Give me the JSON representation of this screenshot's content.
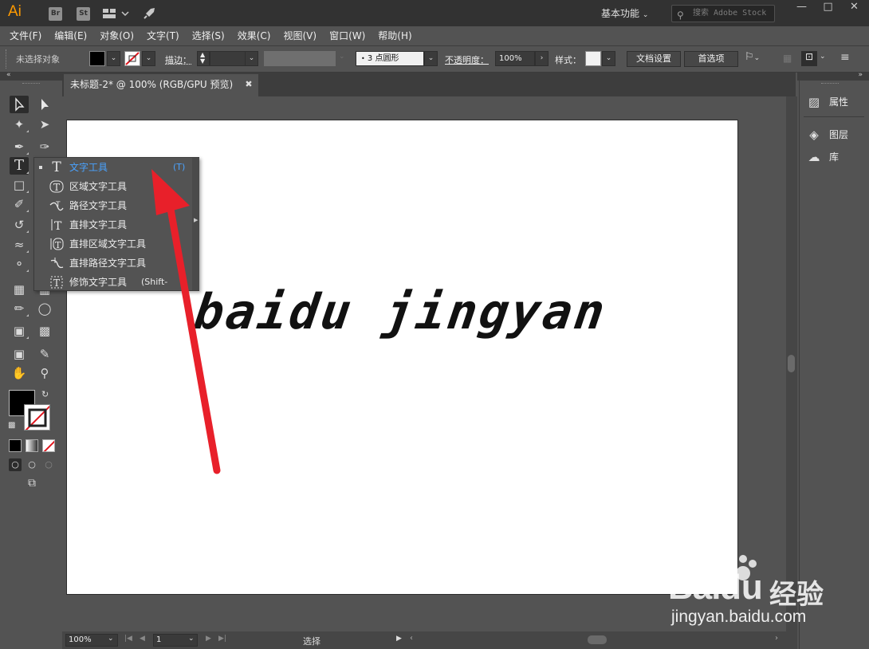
{
  "titlebar": {
    "app_logo": "Ai",
    "bridge_chip": "Br",
    "stock_chip": "St",
    "workspace": "基本功能",
    "search_placeholder": "搜索 Adobe Stock",
    "icons": [
      "layout-icon",
      "rocket-icon",
      "search-icon",
      "minimize-icon",
      "maximize-icon",
      "close-icon"
    ]
  },
  "menu": [
    "文件(F)",
    "编辑(E)",
    "对象(O)",
    "文字(T)",
    "选择(S)",
    "效果(C)",
    "视图(V)",
    "窗口(W)",
    "帮助(H)"
  ],
  "controlbar": {
    "selection_status": "未选择对象",
    "stroke_label": "描边：",
    "brush_value": "3 点圆形",
    "opacity_label": "不透明度：",
    "opacity_value": "100%",
    "style_label": "样式：",
    "doc_setup_button": "文档设置",
    "preferences_button": "首选项"
  },
  "document": {
    "tab_title": "未标题-2* @ 100% (RGB/GPU 预览)",
    "artboard_text": "baidu jingyan"
  },
  "flyout": {
    "items": [
      {
        "label": "文字工具",
        "shortcut": "(T)",
        "icon": "type-tool-icon",
        "selected": true
      },
      {
        "label": "区域文字工具",
        "shortcut": "",
        "icon": "area-type-icon",
        "selected": false
      },
      {
        "label": "路径文字工具",
        "shortcut": "",
        "icon": "type-on-path-icon",
        "selected": false
      },
      {
        "label": "直排文字工具",
        "shortcut": "",
        "icon": "vertical-type-icon",
        "selected": false
      },
      {
        "label": "直排区域文字工具",
        "shortcut": "",
        "icon": "vertical-area-type-icon",
        "selected": false
      },
      {
        "label": "直排路径文字工具",
        "shortcut": "",
        "icon": "vertical-path-type-icon",
        "selected": false
      },
      {
        "label": "修饰文字工具",
        "shortcut": "(Shift-",
        "icon": "touch-type-icon",
        "selected": false
      }
    ]
  },
  "rightpanel": {
    "items": [
      {
        "label": "属性",
        "icon": "properties-icon"
      },
      {
        "label": "图层",
        "icon": "layers-icon"
      },
      {
        "label": "库",
        "icon": "libraries-icon"
      }
    ]
  },
  "statusbar": {
    "zoom": "100%",
    "page": "1",
    "status": "选择"
  },
  "watermark": {
    "brand_left": "Bai",
    "brand_right": "du",
    "brand_cn": "经验",
    "url": "jingyan.baidu.com"
  },
  "colors": {
    "annotation_arrow": "#e8202a",
    "selected_label": "#4aa3ff",
    "ai_logo": "#ff9a00"
  }
}
